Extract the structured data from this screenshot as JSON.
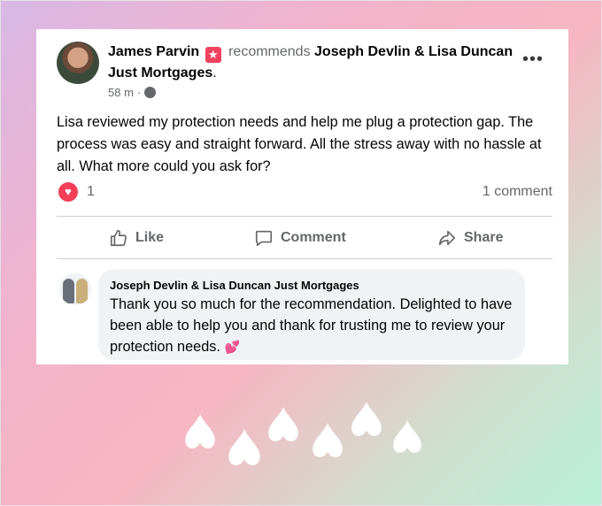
{
  "post": {
    "author": "James Parvin",
    "recommends_word": "recommends",
    "page_name": "Joseph Devlin & Lisa Duncan Just Mortgages",
    "period": ".",
    "time": "58 m",
    "dot": "·",
    "more": "•••",
    "body": "Lisa reviewed my protection needs and help me plug a protection gap. The process was easy and straight forward.  All the stress away with no hassle at all.  What more could you ask for?",
    "reaction_count": "1",
    "comment_count": "1 comment"
  },
  "actions": {
    "like": "Like",
    "comment": "Comment",
    "share": "Share"
  },
  "comment": {
    "author": "Joseph Devlin & Lisa Duncan Just Mortgages",
    "text": "Thank you so much for the recommendation. Delighted to have been able to help you and thank for trusting me to review your protection needs.",
    "emoji": "💕"
  },
  "icons": {
    "recommend_badge": "recommend-star-icon",
    "privacy": "globe-icon",
    "reaction": "heart-reaction-icon",
    "like": "thumbs-up-icon",
    "comment": "speech-bubble-icon",
    "share": "share-arrow-icon"
  },
  "colors": {
    "reaction_red": "#f33e58",
    "text_primary": "#050505",
    "text_secondary": "#65676b",
    "comment_bubble": "#f0f2f5"
  }
}
